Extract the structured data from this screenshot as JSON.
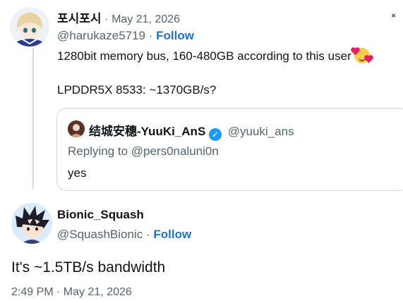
{
  "tweet1": {
    "display_name": "포시포시",
    "date": "· May 21, 2026",
    "handle": "@harukaze5719",
    "follow_label": "Follow",
    "text_line1": "1280bit memory bus, 160-480GB according to this user",
    "text_line2": "LPDDR5X 8533: ~1370GB/s?",
    "emoji": "smiling-face-with-hearts"
  },
  "quote": {
    "display_name": "结城安穗-YuuKi_AnS",
    "handle": "@yuuki_ans",
    "replying": "Replying to @pers0naluni0n",
    "text": "yes"
  },
  "tweet2": {
    "display_name": "Bionic_Squash",
    "handle": "@SquashBionic",
    "separator": "·",
    "follow_label": "Follow",
    "text": "It's ~1.5TB/s bandwidth",
    "timestamp": "2:49 PM · May 21, 2026"
  },
  "colors": {
    "follow": "#1d73c6",
    "muted": "#536471",
    "verified": "#1d9bf0",
    "border": "#cfd9de"
  }
}
